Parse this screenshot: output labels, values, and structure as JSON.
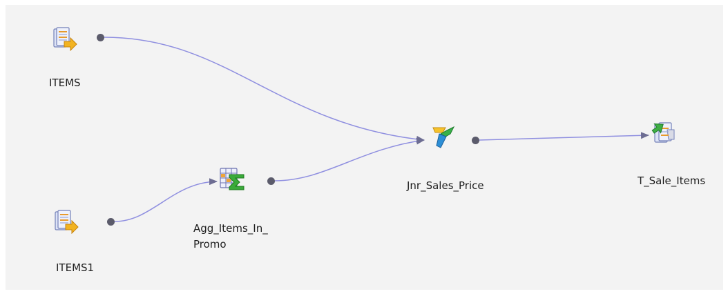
{
  "nodes": {
    "items": {
      "label": "ITEMS",
      "icon": "source-table-icon"
    },
    "items1": {
      "label": "ITEMS1",
      "icon": "source-table-icon"
    },
    "agg": {
      "label_line1": "Agg_Items_In_",
      "label_line2": "Promo",
      "icon": "aggregator-icon"
    },
    "joiner": {
      "label": "Jnr_Sales_Price",
      "icon": "joiner-icon"
    },
    "target": {
      "label": "T_Sale_Items",
      "icon": "target-table-icon"
    }
  },
  "colors": {
    "canvas": "#f3f3f3",
    "link": "#8f8fe0",
    "arrow": "#6d6d92",
    "port": "#5b5b6b",
    "label": "#1e1e1e"
  }
}
